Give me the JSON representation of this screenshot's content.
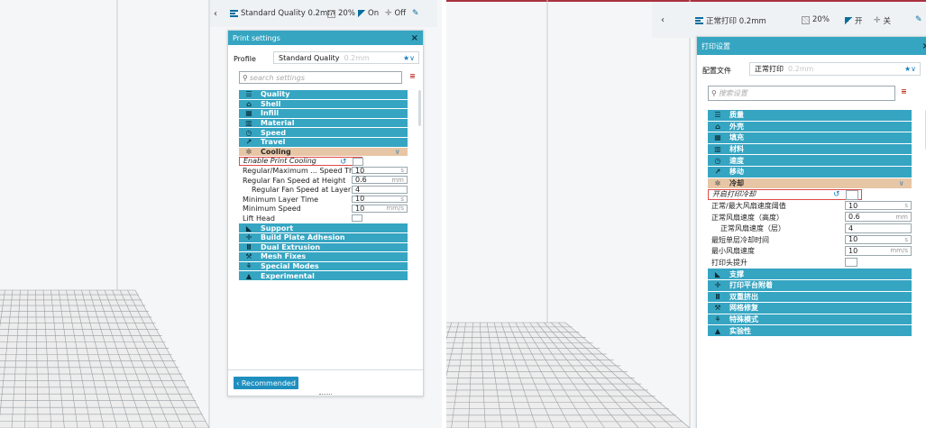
{
  "left": {
    "topbar": {
      "chevron": "‹",
      "quality_profile": "Standard Quality 0.2mm",
      "infill": "20%",
      "support": "On",
      "adhesion": "Off"
    },
    "panel": {
      "title": "Print settings",
      "close": "×",
      "profile_label": "Profile",
      "profile_name": "Standard Quality",
      "profile_layer": "0.2mm",
      "profile_star": "★∨",
      "search_placeholder": "search settings",
      "menu_icon": "≡",
      "categories_top": [
        {
          "label": "Quality",
          "icon": "quality-icon",
          "glyph": "☰"
        },
        {
          "label": "Shell",
          "icon": "shell-icon",
          "glyph": "⌂"
        },
        {
          "label": "Infill",
          "icon": "infill-icon",
          "glyph": "▦"
        },
        {
          "label": "Material",
          "icon": "material-icon",
          "glyph": "▥"
        },
        {
          "label": "Speed",
          "icon": "speed-icon",
          "glyph": "◷"
        },
        {
          "label": "Travel",
          "icon": "travel-icon",
          "glyph": "↗"
        },
        {
          "label": "Cooling",
          "icon": "cooling-icon",
          "glyph": "✼"
        }
      ],
      "cooling_settings": [
        {
          "label": "Enable Print Cooling",
          "type": "checkbox"
        },
        {
          "label": "Regular/Maximum ... Speed Threshold",
          "value": "10",
          "unit": "s"
        },
        {
          "label": "Regular Fan Speed at Height",
          "value": "0.6",
          "unit": "mm"
        },
        {
          "label": "Regular Fan Speed at Layer",
          "value": "4",
          "unit": ""
        },
        {
          "label": "Minimum Layer Time",
          "value": "10",
          "unit": "s"
        },
        {
          "label": "Minimum Speed",
          "value": "10",
          "unit": "mm/s"
        },
        {
          "label": "Lift Head",
          "type": "checkbox"
        }
      ],
      "categories_bottom": [
        {
          "label": "Support",
          "icon": "support-icon",
          "glyph": "◣"
        },
        {
          "label": "Build Plate Adhesion",
          "icon": "adhesion-icon",
          "glyph": "✛"
        },
        {
          "label": "Dual Extrusion",
          "icon": "dual-extrusion-icon",
          "glyph": "Ⅱ"
        },
        {
          "label": "Mesh Fixes",
          "icon": "mesh-fixes-icon",
          "glyph": "⚒"
        },
        {
          "label": "Special Modes",
          "icon": "special-modes-icon",
          "glyph": "⚘"
        },
        {
          "label": "Experimental",
          "icon": "experimental-icon",
          "glyph": "▲"
        }
      ],
      "recommended_label": "‹ Recommended"
    }
  },
  "right": {
    "topbar": {
      "chevron": "‹",
      "quality_profile": "正常打印 0.2mm",
      "infill": "20%",
      "support": "开",
      "adhesion": "关"
    },
    "panel": {
      "title": "打印设置",
      "close": "×",
      "profile_label": "配置文件",
      "profile_name": "正常打印",
      "profile_layer": "0.2mm",
      "profile_star": "★∨",
      "search_placeholder": "搜索设置",
      "menu_icon": "≡",
      "categories_top": [
        {
          "label": "质量",
          "icon": "quality-icon",
          "glyph": "☰"
        },
        {
          "label": "外壳",
          "icon": "shell-icon",
          "glyph": "⌂"
        },
        {
          "label": "填充",
          "icon": "infill-icon",
          "glyph": "▦"
        },
        {
          "label": "材料",
          "icon": "material-icon",
          "glyph": "▥"
        },
        {
          "label": "速度",
          "icon": "speed-icon",
          "glyph": "◷"
        },
        {
          "label": "移动",
          "icon": "travel-icon",
          "glyph": "↗"
        },
        {
          "label": "冷却",
          "icon": "cooling-icon",
          "glyph": "✼"
        }
      ],
      "cooling_settings": [
        {
          "label": "开启打印冷却",
          "type": "checkbox"
        },
        {
          "label": "正常/最大风扇速度阈值",
          "value": "10",
          "unit": "s"
        },
        {
          "label": "正常风扇速度（高度）",
          "value": "0.6",
          "unit": "mm"
        },
        {
          "label": "正常风扇速度（层）",
          "value": "4",
          "unit": ""
        },
        {
          "label": "最短单层冷却时间",
          "value": "10",
          "unit": "s"
        },
        {
          "label": "最小风扇速度",
          "value": "10",
          "unit": "mm/s"
        },
        {
          "label": "打印头提升",
          "type": "checkbox"
        }
      ],
      "categories_bottom": [
        {
          "label": "支撑",
          "icon": "support-icon",
          "glyph": "◣"
        },
        {
          "label": "打印平台附着",
          "icon": "adhesion-icon",
          "glyph": "✛"
        },
        {
          "label": "双重挤出",
          "icon": "dual-extrusion-icon",
          "glyph": "Ⅱ"
        },
        {
          "label": "网格修复",
          "icon": "mesh-fixes-icon",
          "glyph": "⚒"
        },
        {
          "label": "特殊模式",
          "icon": "special-modes-icon",
          "glyph": "⚘"
        },
        {
          "label": "实验性",
          "icon": "experimental-icon",
          "glyph": "▲"
        }
      ]
    }
  }
}
